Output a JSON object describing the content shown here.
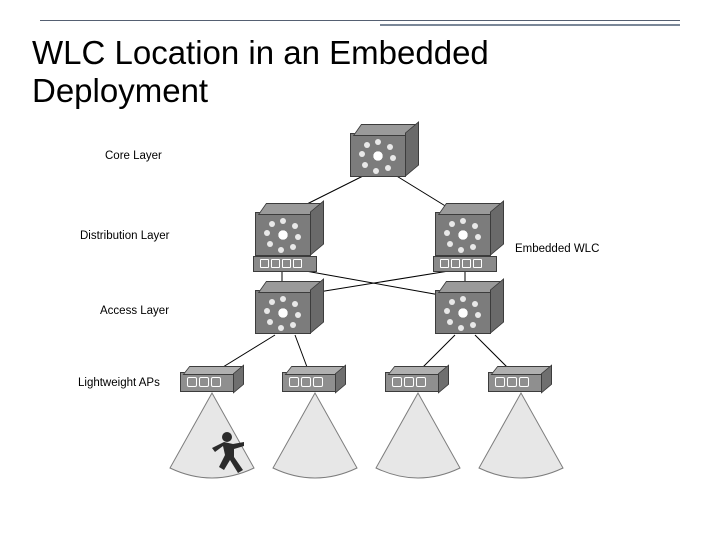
{
  "title_line1": "WLC Location in an Embedded",
  "title_line2": "Deployment",
  "labels": {
    "core": "Core Layer",
    "distribution": "Distribution Layer",
    "access": "Access Layer",
    "aps": "Lightweight APs",
    "embedded": "Embedded WLC"
  },
  "layers": {
    "core": {
      "count": 1
    },
    "distribution": {
      "count": 2,
      "embedded_wlc": true
    },
    "access": {
      "count": 2
    },
    "aps": {
      "count": 4
    }
  },
  "chart_data": {
    "type": "diagram",
    "title": "WLC Location in an Embedded Deployment",
    "nodes": [
      {
        "id": "core1",
        "layer": "Core Layer",
        "kind": "l3-switch"
      },
      {
        "id": "dist1",
        "layer": "Distribution Layer",
        "kind": "l3-switch",
        "module": "Embedded WLC"
      },
      {
        "id": "dist2",
        "layer": "Distribution Layer",
        "kind": "l3-switch",
        "module": "Embedded WLC"
      },
      {
        "id": "acc1",
        "layer": "Access Layer",
        "kind": "l3-switch"
      },
      {
        "id": "acc2",
        "layer": "Access Layer",
        "kind": "l3-switch"
      },
      {
        "id": "ap1",
        "layer": "Lightweight APs",
        "kind": "access-point"
      },
      {
        "id": "ap2",
        "layer": "Lightweight APs",
        "kind": "access-point"
      },
      {
        "id": "ap3",
        "layer": "Lightweight APs",
        "kind": "access-point"
      },
      {
        "id": "ap4",
        "layer": "Lightweight APs",
        "kind": "access-point"
      },
      {
        "id": "user",
        "layer": "",
        "kind": "end-user"
      }
    ],
    "edges": [
      [
        "core1",
        "dist1"
      ],
      [
        "core1",
        "dist2"
      ],
      [
        "dist1",
        "acc1"
      ],
      [
        "dist1",
        "acc2"
      ],
      [
        "dist2",
        "acc1"
      ],
      [
        "dist2",
        "acc2"
      ],
      [
        "acc1",
        "ap1"
      ],
      [
        "acc1",
        "ap2"
      ],
      [
        "acc2",
        "ap3"
      ],
      [
        "acc2",
        "ap4"
      ]
    ],
    "annotations": [
      {
        "target": [
          "dist1",
          "dist2"
        ],
        "text": "Embedded WLC"
      }
    ]
  }
}
